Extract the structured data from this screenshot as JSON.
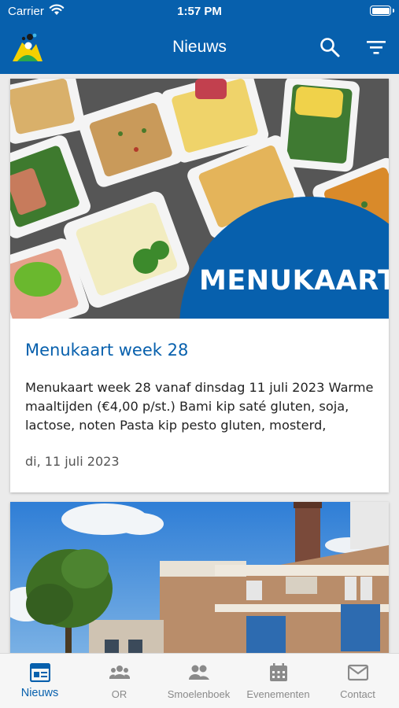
{
  "status": {
    "carrier": "Carrier",
    "time": "1:57 PM"
  },
  "appbar": {
    "title": "Nieuws"
  },
  "colors": {
    "primary": "#0760ad",
    "tab_inactive": "#8a8a8a"
  },
  "icons": {
    "search": "search-icon",
    "filter": "filter-icon",
    "logo": "app-logo"
  },
  "feed": {
    "items": [
      {
        "image_label": "MENUKAART",
        "title": "Menukaart week 28",
        "excerpt": "Menukaart week 28 vanaf dinsdag 11 juli 2023 Warme maaltijden (€4,00 p/st.) Bami kip saté gluten, soja, lactose, noten Pasta kip pesto gluten, mosterd,",
        "date": "di, 11 juli 2023"
      }
    ]
  },
  "tabs": [
    {
      "label": "Nieuws",
      "icon": "newspaper-icon",
      "active": true
    },
    {
      "label": "OR",
      "icon": "group-icon",
      "active": false
    },
    {
      "label": "Smoelenboek",
      "icon": "people-icon",
      "active": false
    },
    {
      "label": "Evenementen",
      "icon": "calendar-icon",
      "active": false
    },
    {
      "label": "Contact",
      "icon": "mail-icon",
      "active": false
    }
  ]
}
